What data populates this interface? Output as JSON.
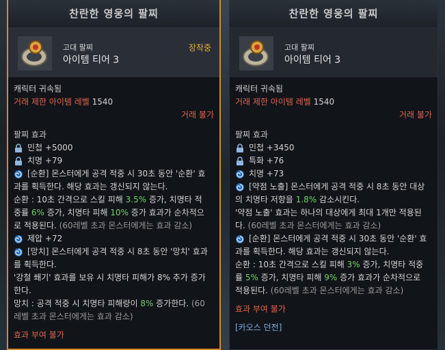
{
  "left": {
    "title": "찬란한 영웅의 팔찌",
    "grade": "고대 팔찌",
    "tier": "아이템 티어 3",
    "equipped": "장착중",
    "bound": "캐릭터 귀속됨",
    "level_label": "거래 제한 아이템 레벨",
    "level_value": "1540",
    "trade": "거래 불가",
    "section": "팔찌 효과",
    "stats": [
      {
        "icon": "lock-icon",
        "text": "민첩 +5000"
      },
      {
        "icon": "lock-icon",
        "text": "치명 +79"
      }
    ],
    "effect1": {
      "l1": "[순환] 몬스터에게 공격 적중 시 30초 동안 '순환' 효",
      "l2": "과를 획득한다. 해당 효과는 갱신되지 않는다.",
      "l3a": "순환 : 10초 간격으로 스킬 피해 ",
      "l3b": "3.5%",
      "l3c": " 증가, 치명타 적",
      "l4a": "중률 ",
      "l4b": "6%",
      "l4c": " 증가, 치명타 피해 ",
      "l4d": "10%",
      "l4e": " 증가 효과가 순차적으",
      "l5a": "로 적용된다. ",
      "l5b": "(60레벨 초과 몬스터에게는 효과 감소)"
    },
    "stat3": "제압 +72",
    "effect2": {
      "l1": "[망치] 몬스터에게 공격 적중 시 8초 동안 '망치' 효과",
      "l2": "를 획득한다.",
      "l3": "'강철 쐐기' 효과를 보유 시 치명타 피해가 8% 추가 증가",
      "l4": "한다.",
      "l5a": "망치 : 공격 적중 시 치명타 피해량이 ",
      "l5b": "8%",
      "l5c": " 증가한다. ",
      "l5d": "(60",
      "l6": "레벨 초과 몬스터에게는 효과 감소)"
    },
    "footer": "효과 부여 불가"
  },
  "right": {
    "title": "찬란한 영웅의 팔찌",
    "grade": "고대 팔찌",
    "tier": "아이템 티어 3",
    "bound": "캐릭터 귀속됨",
    "level_label": "거래 제한 아이템 레벨",
    "level_value": "1540",
    "trade": "거래 불가",
    "section": "팔찌 효과",
    "stats": [
      {
        "icon": "lock-icon",
        "text": "민첩 +3450"
      },
      {
        "icon": "lock-icon",
        "text": "특화 +76"
      },
      {
        "icon": "swirl-icon",
        "text": "치명 +73"
      }
    ],
    "effect1": {
      "l1": "[약점 노출] 몬스터에게 공격 적중 시 8초 동안 대상",
      "l2a": "의 치명타 저항을 ",
      "l2b": "1.8%",
      "l2c": " 감소시킨다.",
      "l3": "'약점 노출' 효과는 하나의 대상에게 최대 1개만 적용된",
      "l4a": "다. ",
      "l4b": "(60레벨 초과 몬스터에게는 효과 감소)"
    },
    "effect2": {
      "l1": "[순환] 몬스터에게 공격 적중 시 30초 동안 '순환' 효",
      "l2": "과를 획득한다. 해당 효과는 갱신되지 않는다.",
      "l3a": "순환 : 10초 간격으로 스킬 피해 ",
      "l3b": "3%",
      "l3c": " 증가, 치명타 적중",
      "l4a": "률 ",
      "l4b": "5%",
      "l4c": " 증가, 치명타 피해 ",
      "l4d": "9%",
      "l4e": " 증가 효과가 순차적으로",
      "l5a": "적용된다. ",
      "l5b": "(60레벨 초과 몬스터에게는 효과 감소)"
    },
    "footer": "효과 부여 불가",
    "chaos": "[카오스 던전]"
  },
  "colors": {
    "accent_border": "#d98a2b",
    "red": "#e0654c",
    "green": "#74d26b",
    "gold": "#e6a93b"
  }
}
